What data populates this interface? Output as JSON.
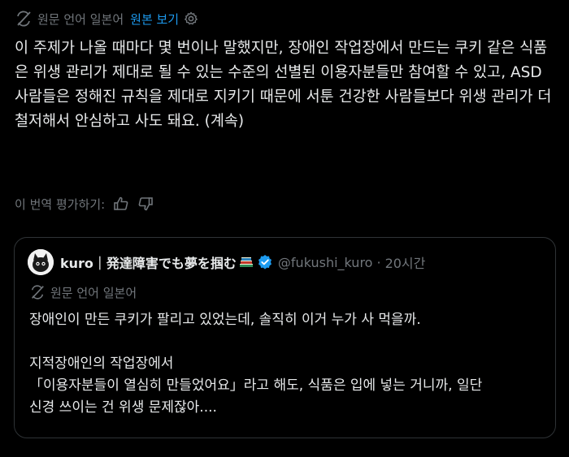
{
  "translation_bar": {
    "source_label": "원문 언어 일본어",
    "view_original": "원본 보기",
    "icon": "translate-icon",
    "settings_icon": "gear-icon"
  },
  "tweet": {
    "text": "이 주제가 나올 때마다 몇 번이나 말했지만, 장애인 작업장에서 만드는 쿠키 같은 식품은 위생 관리가 제대로 될 수 있는 수준의 선별된 이용자분들만 참여할 수 있고, ASD 사람들은 정해진 규칙을 제대로 지키기 때문에 서툰 건강한 사람들보다 위생 관리가 더 철저해서 안심하고 사도 돼요. (계속)"
  },
  "rate": {
    "label": "이 번역 평가하기:",
    "thumbs_up_icon": "thumbs-up-icon",
    "thumbs_down_icon": "thumbs-down-icon"
  },
  "quote": {
    "display_name": "kuro｜発達障害でも夢を掴む",
    "handle": "@fukushi_kuro",
    "separator": "·",
    "time": "20시간",
    "source_label": "원문 언어 일본어",
    "lines": [
      "장애인이 만든 쿠키가 팔리고 있었는데, 솔직히 이거 누가 사 먹을까.",
      "",
      "지적장애인의 작업장에서",
      "「이용자분들이 열심히 만들었어요」라고 해도, 식품은 입에 넣는 거니까, 일단",
      "신경 쓰이는 건 위생 문제잖아...."
    ]
  },
  "colors": {
    "background": "#000000",
    "text": "#e7e9ea",
    "muted": "#71767b",
    "link": "#1d9bf0",
    "border": "#2f3336",
    "verified": "#1d9bf0"
  }
}
